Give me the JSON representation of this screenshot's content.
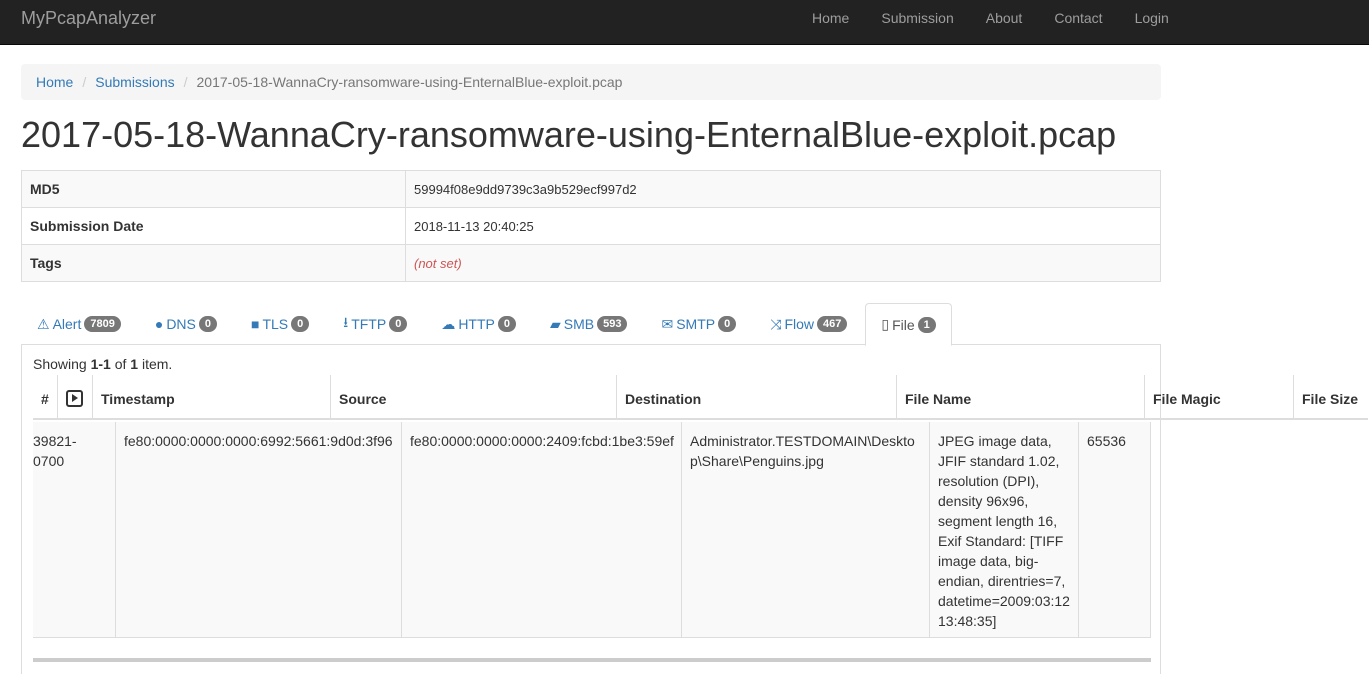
{
  "navbar": {
    "brand": "MyPcapAnalyzer",
    "items": [
      "Home",
      "Submission",
      "About",
      "Contact",
      "Login"
    ]
  },
  "breadcrumb": {
    "home": "Home",
    "submissions": "Submissions",
    "current": "2017-05-18-WannaCry-ransomware-using-EnternalBlue-exploit.pcap"
  },
  "page": {
    "title": "2017-05-18-WannaCry-ransomware-using-EnternalBlue-exploit.pcap"
  },
  "details": {
    "md5_label": "MD5",
    "md5_value": "59994f08e9dd9739c3a9b529ecf997d2",
    "date_label": "Submission Date",
    "date_value": "2018-11-13 20:40:25",
    "tags_label": "Tags",
    "tags_value": "(not set)"
  },
  "tabs": [
    {
      "label": "Alert",
      "count": "7809",
      "icon": "warning-icon",
      "glyph": "⚠"
    },
    {
      "label": "DNS",
      "count": "0",
      "icon": "globe-icon",
      "glyph": "●"
    },
    {
      "label": "TLS",
      "count": "0",
      "icon": "lock-icon",
      "glyph": "■"
    },
    {
      "label": "TFTP",
      "count": "0",
      "icon": "download-icon",
      "glyph": "⭳"
    },
    {
      "label": "HTTP",
      "count": "0",
      "icon": "cloud-download-icon",
      "glyph": "☁"
    },
    {
      "label": "SMB",
      "count": "593",
      "icon": "folder-open-icon",
      "glyph": "▰"
    },
    {
      "label": "SMTP",
      "count": "0",
      "icon": "envelope-icon",
      "glyph": "✉"
    },
    {
      "label": "Flow",
      "count": "467",
      "icon": "shuffle-icon",
      "glyph": "⤨"
    },
    {
      "label": "File",
      "count": "1",
      "icon": "file-icon",
      "glyph": "▯"
    }
  ],
  "grid": {
    "summary_prefix": "Showing ",
    "summary_range": "1-1",
    "summary_of": " of ",
    "summary_total": "1",
    "summary_suffix": " item.",
    "headers": {
      "num": "#",
      "timestamp": "Timestamp",
      "source": "Source",
      "destination": "Destination",
      "file_name": "File Name",
      "file_magic": "File Magic",
      "file_size": "File Size"
    },
    "row": {
      "timestamp": "39821-0700",
      "source": "fe80:0000:0000:0000:6992:5661:9d0d:3f96",
      "destination": "fe80:0000:0000:0000:2409:fcbd:1be3:59ef",
      "file_name": "Administrator.TESTDOMAIN\\Desktop\\Share\\Penguins.jpg",
      "file_magic": "JPEG image data, JFIF standard 1.02, resolution (DPI), density 96x96, segment length 16, Exif Standard: [TIFF image data, big-endian, direntries=7, datetime=2009:03:12 13:48:35]",
      "file_size": "65536"
    }
  }
}
